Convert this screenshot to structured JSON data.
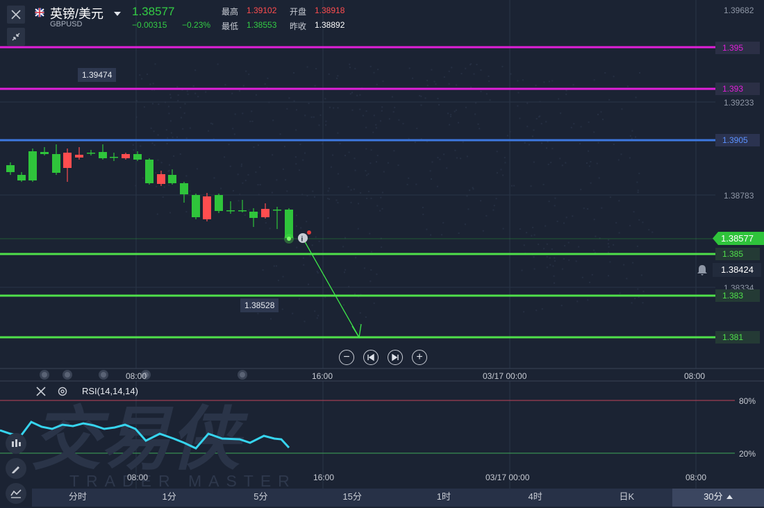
{
  "header": {
    "symbol_cn": "英镑/美元",
    "symbol_code": "GBPUSD",
    "last_price": "1.38577",
    "change": "−0.00315",
    "change_pct": "−0.23%",
    "high_label": "最高",
    "high_value": "1.39102",
    "open_label": "开盘",
    "open_value": "1.38918",
    "low_label": "最低",
    "low_value": "1.38553",
    "prev_close_label": "昨收",
    "prev_close_value": "1.38892"
  },
  "price_axis": {
    "ticks": [
      "1.39682",
      "1.39233",
      "1.38783",
      "1.38334"
    ]
  },
  "horizontal_lines": [
    {
      "label": "1.395",
      "color": "#e01fd8"
    },
    {
      "label": "1.393",
      "color": "#e01fd8"
    },
    {
      "label": "1.3905",
      "color": "#3d78e0"
    },
    {
      "label": "1.385",
      "color": "#4fe04a"
    },
    {
      "label": "1.383",
      "color": "#4fe04a"
    },
    {
      "label": "1.381",
      "color": "#4fe04a"
    }
  ],
  "current_price_tag": "1.38577",
  "alert_price": "1.38424",
  "floating_labels": {
    "high_marker": "1.39474",
    "low_marker": "1.38528"
  },
  "time_axis": {
    "labels": [
      "08:00",
      "16:00",
      "03/17 00:00",
      "08:00"
    ]
  },
  "rsi": {
    "title": "RSI(14,14,14)",
    "level_high": "80%",
    "level_low": "20%"
  },
  "watermark": {
    "cn": "交易侠",
    "en": "TRADER MASTER"
  },
  "timeframes": [
    "分时",
    "1分",
    "5分",
    "15分",
    "1时",
    "4时",
    "日K",
    "30分"
  ],
  "active_timeframe": "30分",
  "colors": {
    "up": "#ff4d4f",
    "down": "#2fc43b",
    "background": "#1b2333",
    "rsi_line": "#36d4ee"
  }
}
